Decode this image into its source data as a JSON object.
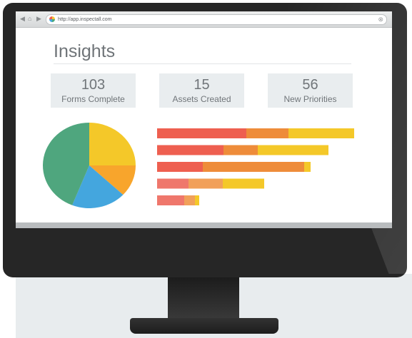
{
  "browser": {
    "url": "http://app.inspectall.com",
    "back_icon": "chevron-left-icon",
    "home_icon": "home-icon",
    "forward_icon": "chevron-right-icon",
    "close_icon": "close-icon"
  },
  "page": {
    "title": "Insights"
  },
  "stats": [
    {
      "value": "103",
      "label": "Forms Complete"
    },
    {
      "value": "15",
      "label": "Assets Created"
    },
    {
      "value": "56",
      "label": "New Priorities"
    }
  ],
  "colors": {
    "red": "#ee5f50",
    "orange": "#ee8c3a",
    "yellow": "#f4c829",
    "light_red": "#ef776c",
    "light_orange": "#f1a05a",
    "pie_green": "#4fa67e",
    "pie_yellow": "#f4c829",
    "pie_orange": "#f8a52c",
    "pie_blue": "#44a6de"
  },
  "pie_chart": {
    "slices": [
      {
        "color": "pie_yellow",
        "fraction": 0.25
      },
      {
        "color": "pie_orange",
        "fraction": 0.12
      },
      {
        "color": "pie_blue",
        "fraction": 0.19
      },
      {
        "color": "pie_green",
        "fraction": 0.44
      }
    ]
  },
  "bar_chart": {
    "max": 276,
    "rows": [
      {
        "segments": [
          {
            "value": 125,
            "color": "red"
          },
          {
            "value": 59,
            "color": "orange"
          },
          {
            "value": 92,
            "color": "yellow"
          }
        ]
      },
      {
        "segments": [
          {
            "value": 93,
            "color": "red"
          },
          {
            "value": 48,
            "color": "orange"
          },
          {
            "value": 99,
            "color": "yellow"
          }
        ]
      },
      {
        "segments": [
          {
            "value": 64,
            "color": "red"
          },
          {
            "value": 142,
            "color": "orange"
          },
          {
            "value": 9,
            "color": "yellow"
          }
        ]
      },
      {
        "segments": [
          {
            "value": 44,
            "color": "light_red"
          },
          {
            "value": 48,
            "color": "light_orange"
          },
          {
            "value": 58,
            "color": "yellow"
          }
        ]
      },
      {
        "segments": [
          {
            "value": 38,
            "color": "light_red"
          },
          {
            "value": 15,
            "color": "light_orange"
          },
          {
            "value": 6,
            "color": "yellow"
          }
        ]
      }
    ]
  }
}
